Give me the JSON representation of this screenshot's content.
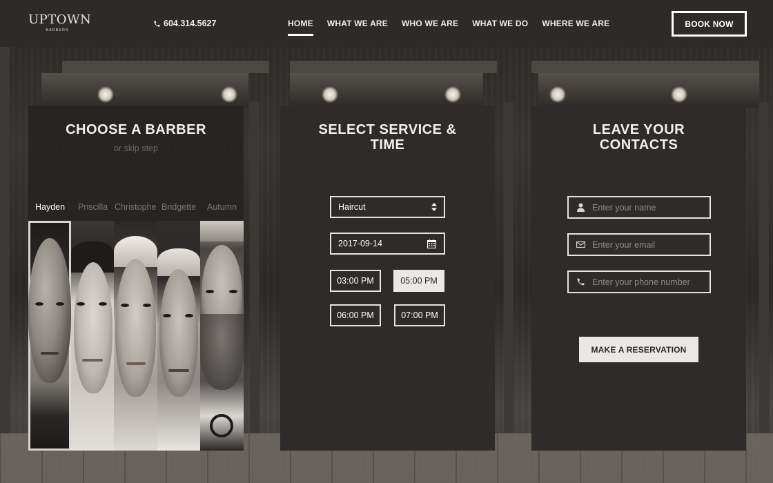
{
  "header": {
    "logo_main": "UPTOWN",
    "logo_sub": "BARBERS",
    "phone": "604.314.5627",
    "nav": [
      {
        "label": "HOME",
        "active": true
      },
      {
        "label": "WHAT WE ARE",
        "active": false
      },
      {
        "label": "WHO WE ARE",
        "active": false
      },
      {
        "label": "WHAT WE DO",
        "active": false
      },
      {
        "label": "WHERE WE ARE",
        "active": false
      }
    ],
    "book_label": "BOOK NOW"
  },
  "barber_panel": {
    "title": "CHOOSE A BARBER",
    "skip_label": "or skip step",
    "barbers": [
      {
        "name": "Hayden",
        "selected": true
      },
      {
        "name": "Priscilla",
        "selected": false
      },
      {
        "name": "Christophe",
        "selected": false
      },
      {
        "name": "Bridgette",
        "selected": false
      },
      {
        "name": "Autumn",
        "selected": false
      }
    ]
  },
  "service_panel": {
    "title_line1": "SELECT SERVICE &",
    "title_line2": "TIME",
    "service": "Haircut",
    "date": "2017-09-14",
    "times": [
      {
        "label": "03:00 PM",
        "selected": false
      },
      {
        "label": "05:00 PM",
        "selected": true
      },
      {
        "label": "06:00 PM",
        "selected": false
      },
      {
        "label": "07:00 PM",
        "selected": false
      }
    ]
  },
  "contact_panel": {
    "title_line1": "LEAVE YOUR",
    "title_line2": "CONTACTS",
    "name_placeholder": "Enter your name",
    "email_placeholder": "Enter your email",
    "phone_placeholder": "Enter your phone number",
    "reserve_label": "MAKE A RESERVATION"
  }
}
